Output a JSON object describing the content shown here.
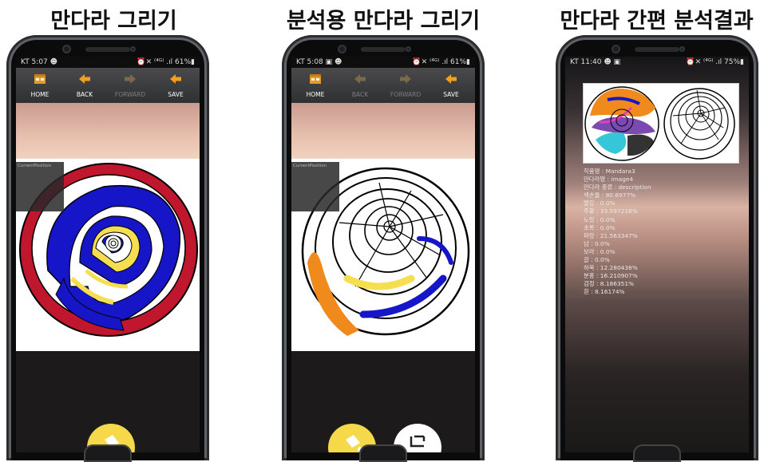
{
  "captions": [
    "만다라 그리기",
    "분석용 만다라 그리기",
    "만다라 간편 분석결과"
  ],
  "phone1": {
    "status_left": "KT 5:07 ☻",
    "status_right": "⏰✕ ⁽⁴ᴳ⁾ .ıl 61%▮",
    "toolbar": [
      {
        "label": "HOME",
        "icon": "home-icon",
        "enabled": true
      },
      {
        "label": "BACK",
        "icon": "back-arrow-icon",
        "enabled": true
      },
      {
        "label": "FORWARD",
        "icon": "forward-arrow-icon",
        "enabled": false
      },
      {
        "label": "SAVE",
        "icon": "save-icon",
        "enabled": true
      }
    ],
    "position_label": "CurrentPosition"
  },
  "phone2": {
    "status_left": "KT 5:08 ▣ ☻",
    "status_right": "⏰✕ ⁽⁴ᴳ⁾ .ıl 61%▮",
    "toolbar": [
      {
        "label": "HOME",
        "icon": "home-icon",
        "enabled": true
      },
      {
        "label": "BACK",
        "icon": "back-arrow-icon",
        "enabled": false
      },
      {
        "label": "FORWARD",
        "icon": "forward-arrow-icon",
        "enabled": false
      },
      {
        "label": "SAVE",
        "icon": "save-icon",
        "enabled": true
      }
    ],
    "position_label": "CurrentPosition"
  },
  "phone3": {
    "status_left": "KT 11:40 ☻ ▣",
    "status_right": "⏰✕ ⁽⁴ᴳ⁾ .ıl 75%▮",
    "stats": [
      "작품명 : Mandara3",
      "만다라명 : image4",
      "만다라 종류 : description",
      "색손율 : 80.6977%",
      "빨강 : 0.0%",
      "주황 : 33.597218%",
      "노랑 : 0.0%",
      "초록 : 0.0%",
      "파랑 : 21.563347%",
      "남 : 0.0%",
      "보라 : 0.0%",
      "갈 : 0.0%",
      "하목 : 12.280438%",
      "분홍 : 16.210907%",
      "검정 : 8.186351%",
      "흰 : 8.16174%"
    ]
  },
  "colors": {
    "toolbar_icon": "#f0a020",
    "fab_yellow": "#f5d94a",
    "mandala_red": "#c0162e",
    "mandala_blue": "#1616c8",
    "mandala_yellow": "#f5de50",
    "mandala_orange": "#f08a1c"
  }
}
